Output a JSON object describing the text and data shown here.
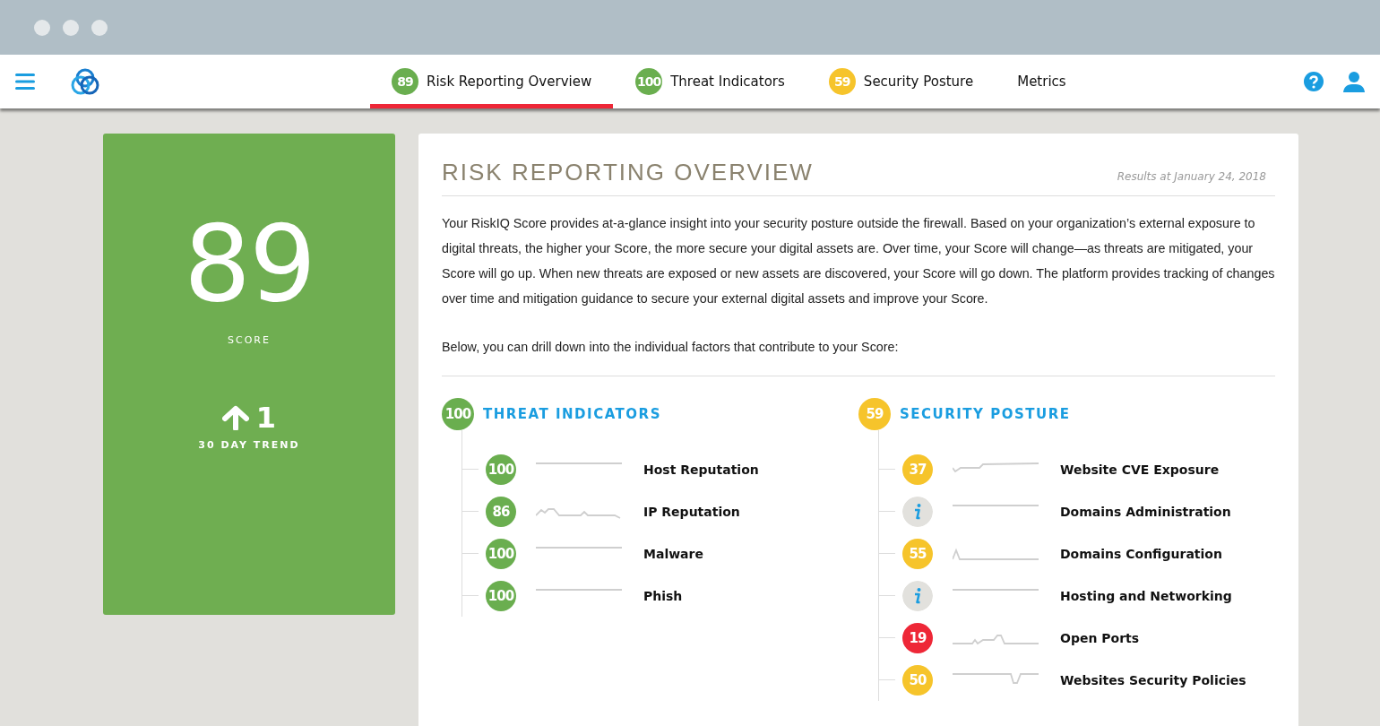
{
  "nav": {
    "tabs": [
      {
        "score": "89",
        "label": "Risk Reporting Overview",
        "selected": true,
        "color": "#6aae4f"
      },
      {
        "score": "100",
        "label": "Threat Indicators",
        "selected": false,
        "color": "#6aae4f"
      },
      {
        "score": "59",
        "label": "Security Posture",
        "selected": false,
        "color": "#f6c42b"
      },
      {
        "label": "Metrics",
        "selected": false
      }
    ]
  },
  "score_card": {
    "score": "89",
    "score_label": "SCORE",
    "trend": "1",
    "trend_label": "30 DAY TREND"
  },
  "overview": {
    "title": "RISK REPORTING OVERVIEW",
    "results_date": "Results at January 24, 2018",
    "paragraphs": [
      "Your RiskIQ Score provides at-a-glance insight into your security posture outside the firewall. Based on your organization’s external exposure to digital threats, the higher your Score, the more secure your digital assets are. Over time, your Score will change—as threats are mitigated, your Score will go up. When new threats are exposed or new assets are discovered, your Score will go down. The platform provides tracking of changes over time and mitigation guidance to secure your external digital assets and improve your Score.",
      "Below, you can drill down into the individual factors that contribute to your Score:"
    ],
    "sections": [
      {
        "score": "100",
        "title": "THREAT INDICATORS",
        "color": "#6aae4f",
        "children": [
          {
            "kind": "score",
            "score": "100",
            "label": "Host Reputation",
            "color": "#6aae4f"
          },
          {
            "kind": "score",
            "score": "86",
            "label": "IP Reputation",
            "color": "#6aae4f"
          },
          {
            "kind": "score",
            "score": "100",
            "label": "Malware",
            "color": "#6aae4f"
          },
          {
            "kind": "score",
            "score": "100",
            "label": "Phish",
            "color": "#6aae4f"
          }
        ]
      },
      {
        "score": "59",
        "title": "SECURITY POSTURE",
        "color": "#f6c42b",
        "children": [
          {
            "kind": "score",
            "score": "37",
            "label": "Website CVE Exposure",
            "color": "#f6c42b"
          },
          {
            "kind": "info",
            "label": "Domains Administration"
          },
          {
            "kind": "score",
            "score": "55",
            "label": "Domains Configuration",
            "color": "#f6c42b"
          },
          {
            "kind": "info",
            "label": "Hosting and Networking"
          },
          {
            "kind": "score",
            "score": "19",
            "label": "Open Ports",
            "color": "#ee2737"
          },
          {
            "kind": "score",
            "score": "50",
            "label": "Websites Security Policies",
            "color": "#f6c42b"
          }
        ]
      }
    ]
  }
}
